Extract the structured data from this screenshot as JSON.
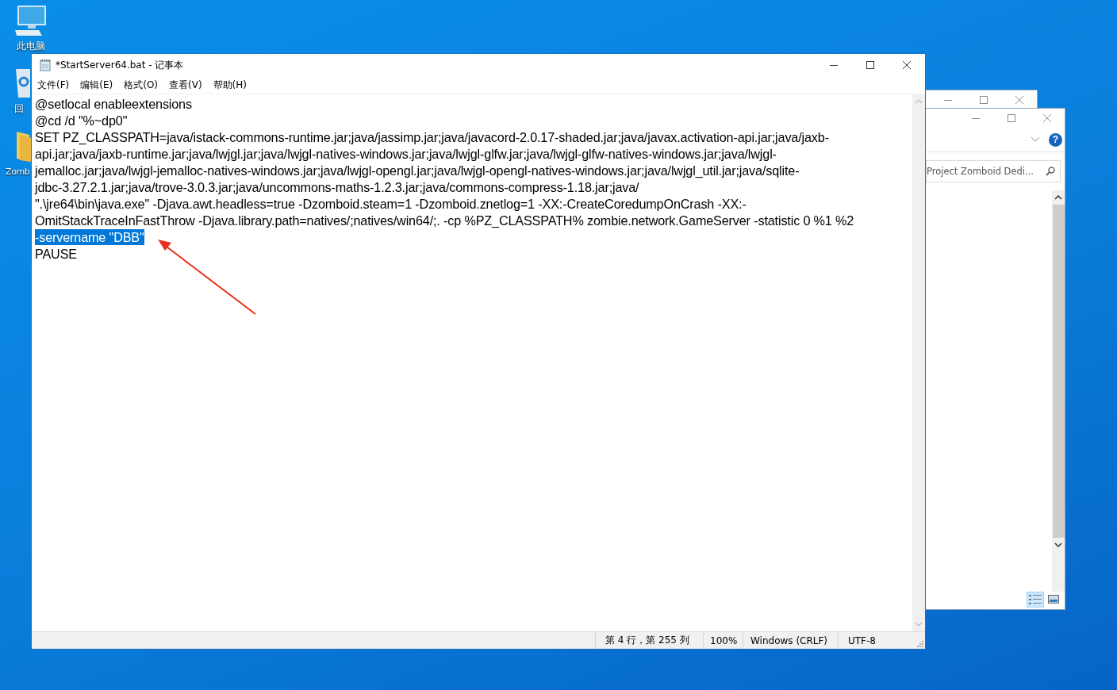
{
  "desktop_icons": [
    {
      "kind": "computer",
      "label": "此电脑"
    },
    {
      "kind": "recycle",
      "label": "回"
    },
    {
      "kind": "folder",
      "label": "Zomb"
    }
  ],
  "background_windows": [
    {
      "kind": "explorer_back"
    },
    {
      "kind": "explorer_front",
      "help": "?",
      "search": {
        "value": "Project Zomboid Dedi..."
      }
    }
  ],
  "notepad": {
    "title": "*StartServer64.bat - 记事本",
    "menu": [
      "文件(F)",
      "编辑(E)",
      "格式(O)",
      "查看(V)",
      "帮助(H)"
    ],
    "lines": [
      {
        "text": "@setlocal enableextensions",
        "selected": false
      },
      {
        "text": "@cd /d \"%~dp0\"",
        "selected": false
      },
      {
        "text": "SET PZ_CLASSPATH=java/istack-commons-runtime.jar;java/jassimp.jar;java/javacord-2.0.17-shaded.jar;java/javax.activation-api.jar;java/jaxb-",
        "selected": false
      },
      {
        "text": "api.jar;java/jaxb-runtime.jar;java/lwjgl.jar;java/lwjgl-natives-windows.jar;java/lwjgl-glfw.jar;java/lwjgl-glfw-natives-windows.jar;java/lwjgl-",
        "selected": false
      },
      {
        "text": "jemalloc.jar;java/lwjgl-jemalloc-natives-windows.jar;java/lwjgl-opengl.jar;java/lwjgl-opengl-natives-windows.jar;java/lwjgl_util.jar;java/sqlite-",
        "selected": false
      },
      {
        "text": "jdbc-3.27.2.1.jar;java/trove-3.0.3.jar;java/uncommons-maths-1.2.3.jar;java/commons-compress-1.18.jar;java/",
        "selected": false
      },
      {
        "text": "\".\\jre64\\bin\\java.exe\" -Djava.awt.headless=true -Dzomboid.steam=1 -Dzomboid.znetlog=1 -XX:-CreateCoredumpOnCrash -XX:-",
        "selected": false
      },
      {
        "text": "OmitStackTraceInFastThrow -Djava.library.path=natives/;natives/win64/;. -cp %PZ_CLASSPATH% zombie.network.GameServer -statistic 0 %1 %2",
        "selected": false
      },
      {
        "text": "-servername \"DBB\"",
        "selected": true
      },
      {
        "text": "PAUSE",
        "selected": false
      }
    ],
    "status_bar": [
      "第 4 行，第 255 列",
      "100%",
      "Windows (CRLF)",
      "UTF-8"
    ]
  }
}
